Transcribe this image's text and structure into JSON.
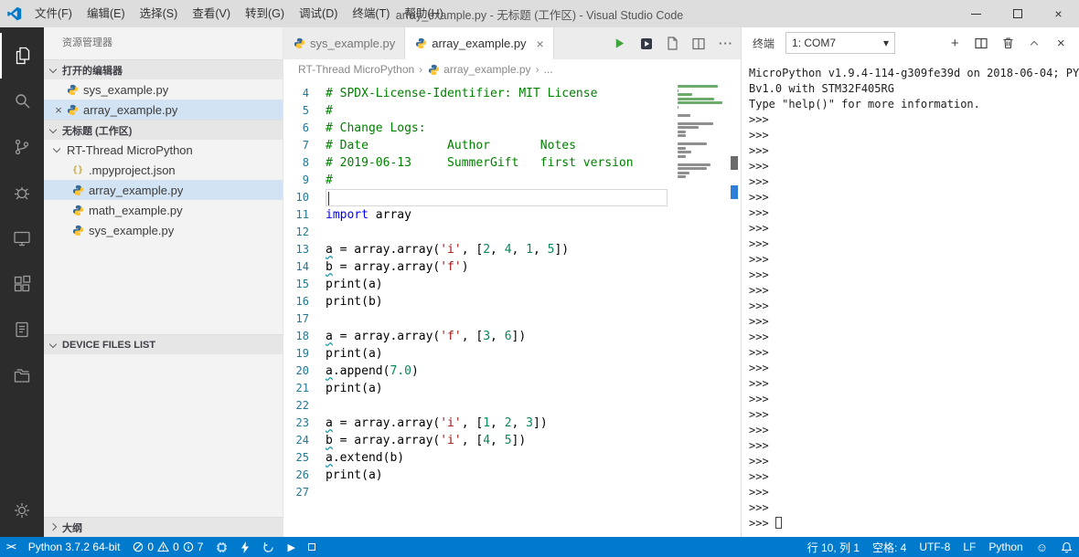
{
  "window": {
    "title": "array_example.py - 无标题 (工作区) - Visual Studio Code",
    "menus": [
      "文件(F)",
      "编辑(E)",
      "选择(S)",
      "查看(V)",
      "转到(G)",
      "调试(D)",
      "终端(T)",
      "帮助(H)"
    ]
  },
  "sidebar": {
    "title": "资源管理器",
    "sections": {
      "open_editors": "打开的编辑器",
      "workspace": "无标题 (工作区)",
      "device_files": "DEVICE FILES LIST",
      "outline": "大纲"
    },
    "open_editors": [
      {
        "label": "sys_example.py",
        "icon": "python",
        "selected": false,
        "close": false
      },
      {
        "label": "array_example.py",
        "icon": "python",
        "selected": true,
        "close": true
      }
    ],
    "tree": [
      {
        "label": "RT-Thread MicroPython",
        "icon": "folder-open",
        "level": 0,
        "selected": false
      },
      {
        "label": ".mpyproject.json",
        "icon": "json",
        "level": 1,
        "selected": false
      },
      {
        "label": "array_example.py",
        "icon": "python",
        "level": 1,
        "selected": true
      },
      {
        "label": "math_example.py",
        "icon": "python",
        "level": 1,
        "selected": false
      },
      {
        "label": "sys_example.py",
        "icon": "python",
        "level": 1,
        "selected": false
      }
    ]
  },
  "editor": {
    "tabs": [
      {
        "label": "sys_example.py",
        "icon": "python",
        "active": false,
        "close": false
      },
      {
        "label": "array_example.py",
        "icon": "python",
        "active": true,
        "close": true
      }
    ],
    "breadcrumb": [
      {
        "label": "RT-Thread MicroPython"
      },
      {
        "label": "array_example.py",
        "icon": "python"
      },
      {
        "label": "..."
      }
    ],
    "code_lines": [
      {
        "n": 4,
        "seg": [
          [
            "cm",
            "# SPDX-License-Identifier: MIT License"
          ]
        ]
      },
      {
        "n": 5,
        "seg": [
          [
            "cm",
            "#"
          ]
        ]
      },
      {
        "n": 6,
        "seg": [
          [
            "cm",
            "# Change Logs:"
          ]
        ]
      },
      {
        "n": 7,
        "seg": [
          [
            "cm",
            "# Date           Author       Notes"
          ]
        ]
      },
      {
        "n": 8,
        "seg": [
          [
            "cm",
            "# 2019-06-13     SummerGift   first version"
          ]
        ]
      },
      {
        "n": 9,
        "seg": [
          [
            "cm",
            "#"
          ]
        ]
      },
      {
        "n": 10,
        "seg": [],
        "cursor": true
      },
      {
        "n": 11,
        "seg": [
          [
            "kw",
            "import"
          ],
          [
            "pl",
            " array"
          ]
        ]
      },
      {
        "n": 12,
        "seg": []
      },
      {
        "n": 13,
        "sq": true,
        "seg": [
          [
            "pl",
            "a = array.array("
          ],
          [
            "str",
            "'i'"
          ],
          [
            "pl",
            ", ["
          ],
          [
            "num",
            "2"
          ],
          [
            "pl",
            ", "
          ],
          [
            "num",
            "4"
          ],
          [
            "pl",
            ", "
          ],
          [
            "num",
            "1"
          ],
          [
            "pl",
            ", "
          ],
          [
            "num",
            "5"
          ],
          [
            "pl",
            "])"
          ]
        ]
      },
      {
        "n": 14,
        "sq": true,
        "seg": [
          [
            "pl",
            "b = array.array("
          ],
          [
            "str",
            "'f'"
          ],
          [
            "pl",
            ")"
          ]
        ]
      },
      {
        "n": 15,
        "seg": [
          [
            "pl",
            "print(a)"
          ]
        ]
      },
      {
        "n": 16,
        "seg": [
          [
            "pl",
            "print(b)"
          ]
        ]
      },
      {
        "n": 17,
        "seg": []
      },
      {
        "n": 18,
        "sq": true,
        "seg": [
          [
            "pl",
            "a = array.array("
          ],
          [
            "str",
            "'f'"
          ],
          [
            "pl",
            ", ["
          ],
          [
            "num",
            "3"
          ],
          [
            "pl",
            ", "
          ],
          [
            "num",
            "6"
          ],
          [
            "pl",
            "])"
          ]
        ]
      },
      {
        "n": 19,
        "seg": [
          [
            "pl",
            "print(a)"
          ]
        ]
      },
      {
        "n": 20,
        "sq": true,
        "seg": [
          [
            "pl",
            "a.append("
          ],
          [
            "num",
            "7.0"
          ],
          [
            "pl",
            ")"
          ]
        ]
      },
      {
        "n": 21,
        "seg": [
          [
            "pl",
            "print(a)"
          ]
        ]
      },
      {
        "n": 22,
        "seg": []
      },
      {
        "n": 23,
        "sq": true,
        "seg": [
          [
            "pl",
            "a = array.array("
          ],
          [
            "str",
            "'i'"
          ],
          [
            "pl",
            ", ["
          ],
          [
            "num",
            "1"
          ],
          [
            "pl",
            ", "
          ],
          [
            "num",
            "2"
          ],
          [
            "pl",
            ", "
          ],
          [
            "num",
            "3"
          ],
          [
            "pl",
            "])"
          ]
        ]
      },
      {
        "n": 24,
        "sq": true,
        "seg": [
          [
            "pl",
            "b = array.array("
          ],
          [
            "str",
            "'i'"
          ],
          [
            "pl",
            ", ["
          ],
          [
            "num",
            "4"
          ],
          [
            "pl",
            ", "
          ],
          [
            "num",
            "5"
          ],
          [
            "pl",
            "])"
          ]
        ]
      },
      {
        "n": 25,
        "sq": true,
        "seg": [
          [
            "pl",
            "a.extend(b)"
          ]
        ]
      },
      {
        "n": 26,
        "seg": [
          [
            "pl",
            "print(a)"
          ]
        ]
      },
      {
        "n": 27,
        "seg": []
      }
    ]
  },
  "terminal": {
    "title": "终端",
    "dropdown_value": "1: COM7",
    "banner": [
      "MicroPython v1.9.4-114-g309fe39d on 2018-06-04; PY",
      "Bv1.0 with STM32F405RG",
      "Type \"help()\" for more information."
    ],
    "prompt": ">>>",
    "prompt_repeat": 26
  },
  "statusbar": {
    "interpreter": "Python 3.7.2 64-bit",
    "errors": "0",
    "warnings": "0",
    "infos": "7",
    "line_col": "行 10, 列 1",
    "indent": "空格: 4",
    "encoding": "UTF-8",
    "eol": "LF",
    "language": "Python"
  },
  "colors": {
    "statusbar_bg": "#007acc",
    "activitybar_bg": "#2c2c2c",
    "comment": "#008000",
    "keyword": "#0000ff",
    "string": "#a31515",
    "number": "#098658",
    "selection_bg": "#d2e3f4"
  }
}
